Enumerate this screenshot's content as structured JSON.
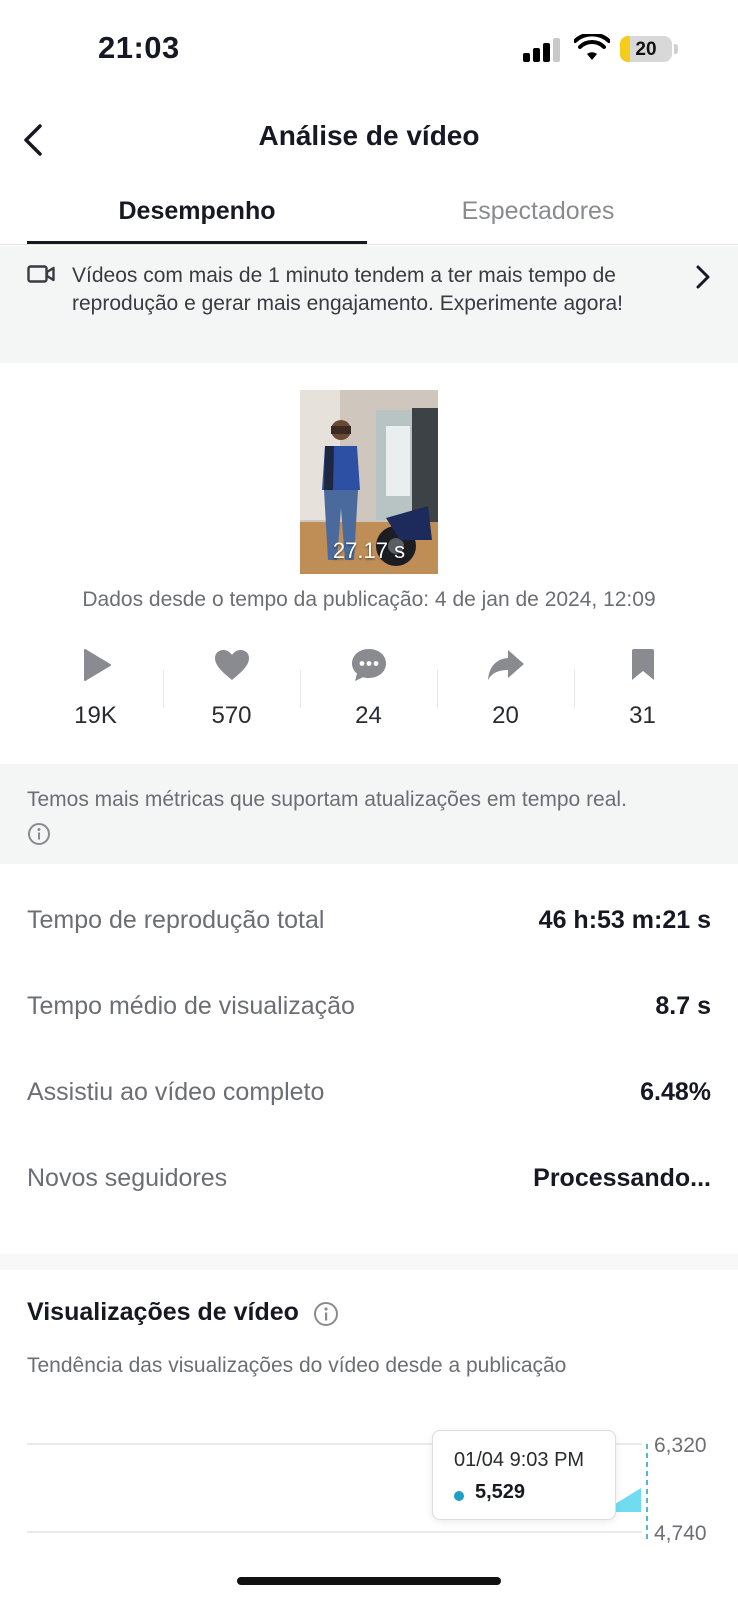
{
  "status_bar": {
    "time": "21:03",
    "battery": "20",
    "battery_fraction": 0.2
  },
  "header": {
    "title": "Análise de vídeo"
  },
  "tabs": [
    {
      "label": "Desempenho",
      "active": true
    },
    {
      "label": "Espectadores",
      "active": false
    }
  ],
  "banner": {
    "icon": "video-camera-icon",
    "text": "Vídeos com mais de 1 minuto tendem a ter mais tempo de reprodução e gerar mais engajamento. Experimente agora!"
  },
  "video": {
    "duration": "27.17 s",
    "published": "Dados desde o tempo da publicação: 4 de jan de 2024, 12:09"
  },
  "stats": [
    {
      "icon": "play-icon",
      "value": "19K"
    },
    {
      "icon": "heart-icon",
      "value": "570"
    },
    {
      "icon": "comment-icon",
      "value": "24"
    },
    {
      "icon": "share-icon",
      "value": "20"
    },
    {
      "icon": "bookmark-icon",
      "value": "31"
    }
  ],
  "realtime_note": "Temos mais métricas que suportam atualizações em tempo real.",
  "metrics": [
    {
      "label": "Tempo de reprodução total",
      "value": "46 h:53 m:21 s"
    },
    {
      "label": "Tempo médio de visualização",
      "value": "8.7 s"
    },
    {
      "label": "Assistiu ao vídeo completo",
      "value": "6.48%"
    },
    {
      "label": "Novos seguidores",
      "value": "Processando..."
    }
  ],
  "views": {
    "title": "Visualizações de vídeo",
    "subtitle": "Tendência das visualizações do vídeo desde a publicação",
    "tooltip_date": "01/04 9:03 PM",
    "tooltip_value": "5,529"
  },
  "chart_data": {
    "type": "area",
    "y_ticks": [
      "6,320",
      "4,740"
    ],
    "ylim": [
      4740,
      6320
    ],
    "points": [
      {
        "x": "01/04 9:03 PM",
        "y": 5529
      }
    ],
    "color": "#5fd8ee"
  },
  "colors": {
    "accent": "#161823",
    "muted": "#6d6e75",
    "tooltip_dot": "#1f9fc4",
    "chart_fill": "#5fd8ee"
  }
}
